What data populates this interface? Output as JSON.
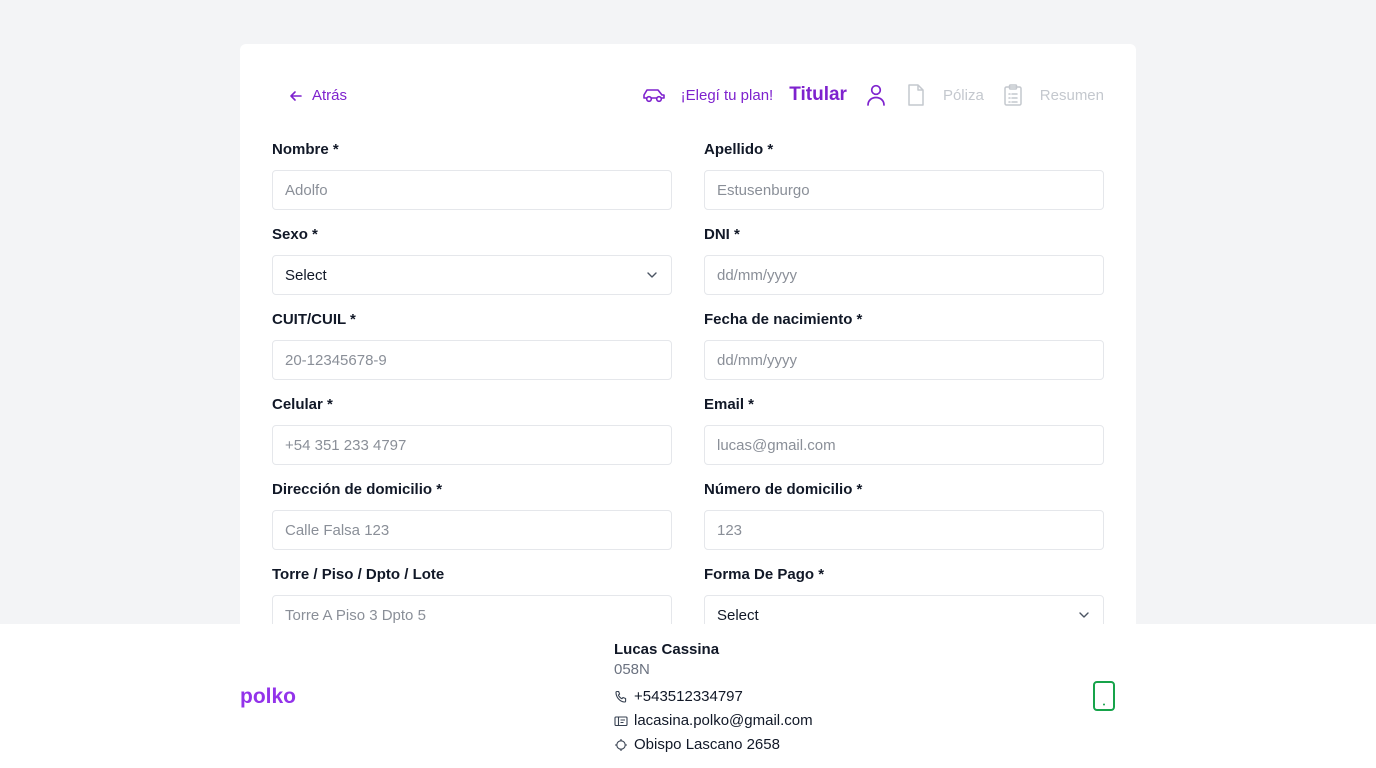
{
  "nav": {
    "back_label": "Atrás",
    "steps": [
      {
        "label": "¡Elegí tu plan!",
        "state": "done",
        "icon": "car-icon"
      },
      {
        "label": "Titular",
        "state": "current",
        "icon": "user-icon"
      },
      {
        "label": "Póliza",
        "state": "pending",
        "icon": "document-icon"
      },
      {
        "label": "Resumen",
        "state": "pending",
        "icon": "clipboard-icon"
      }
    ]
  },
  "form": {
    "nombre": {
      "label": "Nombre *",
      "placeholder": "Adolfo"
    },
    "apellido": {
      "label": "Apellido *",
      "placeholder": "Estusenburgo"
    },
    "sexo": {
      "label": "Sexo *",
      "value": "Select"
    },
    "dni": {
      "label": "DNI *",
      "placeholder": "dd/mm/yyyy"
    },
    "cuit": {
      "label": "CUIT/CUIL *",
      "placeholder": "20-12345678-9"
    },
    "fecha": {
      "label": "Fecha de nacimiento *",
      "placeholder": "dd/mm/yyyy"
    },
    "celular": {
      "label": "Celular *",
      "placeholder": "+54 351 233 4797"
    },
    "email": {
      "label": "Email *",
      "placeholder": "lucas@gmail.com"
    },
    "direccion": {
      "label": "Dirección de domicilio *",
      "placeholder": "Calle Falsa 123"
    },
    "numero": {
      "label": "Número de domicilio *",
      "placeholder": "123"
    },
    "torre": {
      "label": "Torre / Piso / Dpto / Lote",
      "placeholder": "Torre A Piso 3 Dpto 5"
    },
    "pago": {
      "label": "Forma De Pago *",
      "value": "Select"
    }
  },
  "footer": {
    "logo": "polko",
    "agent": {
      "name": "Lucas Cassina",
      "code": "058N",
      "phone": "+543512334797",
      "email": "lacasina.polko@gmail.com",
      "address": "Obispo Lascano 2658"
    }
  },
  "colors": {
    "accent": "#7e22ce",
    "logo": "#9333ea",
    "inactive": "#c4c8ce",
    "whatsapp": "#16a34a"
  }
}
